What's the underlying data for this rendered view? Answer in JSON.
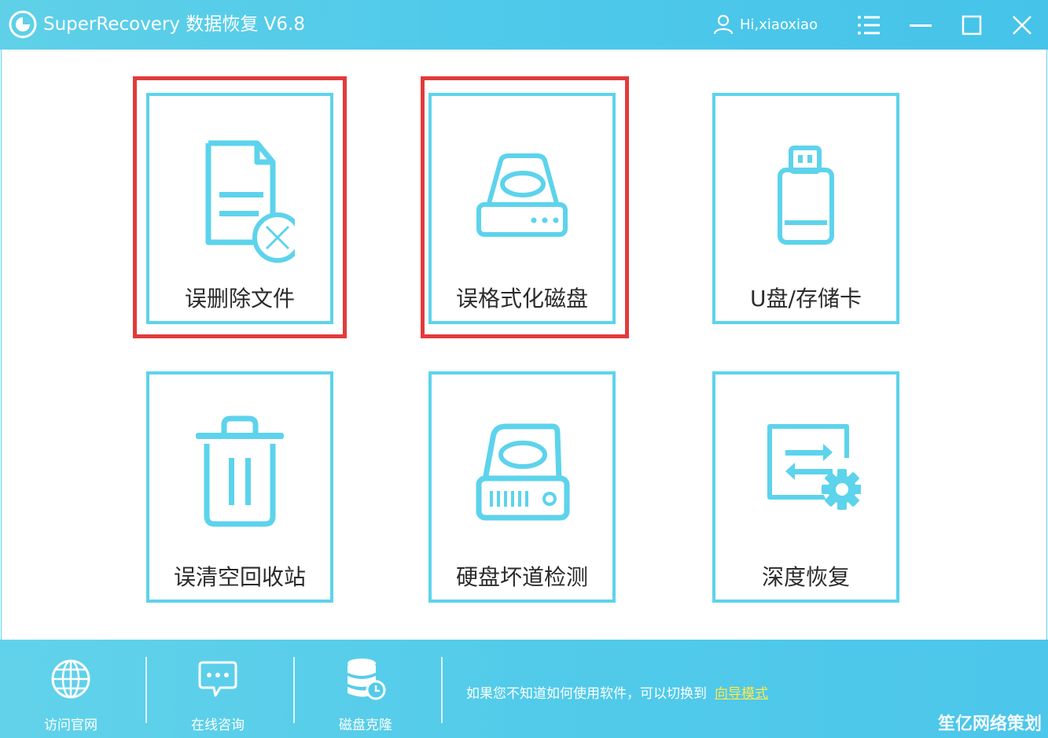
{
  "window": {
    "title": "SuperRecovery 数据恢复 V6.8",
    "user": "Hi,xiaoxiao"
  },
  "cards": [
    {
      "label": "误删除文件",
      "icon": "deleted-file-icon",
      "highlighted": true
    },
    {
      "label": "误格式化磁盘",
      "icon": "disk-icon",
      "highlighted": true
    },
    {
      "label": "U盘/存储卡",
      "icon": "usb-drive-icon",
      "highlighted": false
    },
    {
      "label": "误清空回收站",
      "icon": "trash-icon",
      "highlighted": false
    },
    {
      "label": "硬盘坏道检测",
      "icon": "hard-drive-icon",
      "highlighted": false
    },
    {
      "label": "深度恢复",
      "icon": "deep-recovery-icon",
      "highlighted": false
    }
  ],
  "footer": {
    "items": [
      {
        "label": "访问官网",
        "icon": "globe-icon"
      },
      {
        "label": "在线咨询",
        "icon": "chat-icon"
      },
      {
        "label": "磁盘克隆",
        "icon": "database-clone-icon"
      }
    ],
    "hint_text": "如果您不知道如何使用软件，可以切换到",
    "hint_link": "向导模式"
  },
  "watermark": "笙亿网络策划",
  "colors": {
    "accent": "#5dd3ec",
    "highlight": "#e23b3b",
    "link": "#ffe94a"
  }
}
